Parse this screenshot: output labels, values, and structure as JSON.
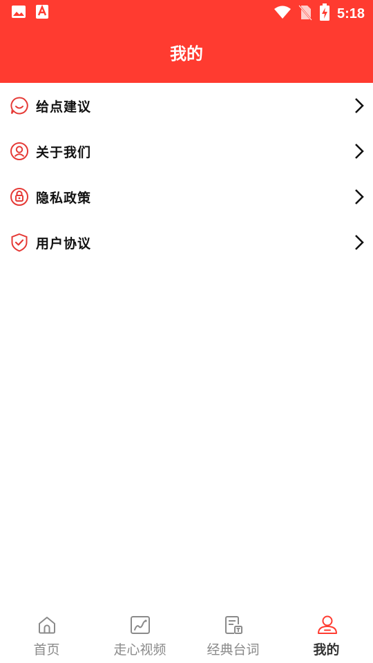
{
  "status_bar": {
    "time": "5:18",
    "left_icons": [
      "image-icon",
      "app-a-icon"
    ],
    "right_icons": [
      "wifi-icon",
      "no-sim-icon",
      "battery-charging-icon"
    ]
  },
  "header": {
    "title": "我的",
    "background_color": "#FF3B30"
  },
  "menu": {
    "accent_color": "#E53935",
    "items": [
      {
        "label": "给点建议",
        "icon": "chat-bubble-icon"
      },
      {
        "label": "关于我们",
        "icon": "user-circle-icon"
      },
      {
        "label": "隐私政策",
        "icon": "lock-circle-icon"
      },
      {
        "label": "用户协议",
        "icon": "shield-check-icon"
      }
    ]
  },
  "bottom_nav": {
    "active_index": 3,
    "active_color": "#FF3B30",
    "items": [
      {
        "label": "首页",
        "icon": "home-icon"
      },
      {
        "label": "走心视频",
        "icon": "video-chart-icon"
      },
      {
        "label": "经典台词",
        "icon": "document-text-icon"
      },
      {
        "label": "我的",
        "icon": "user-icon"
      }
    ]
  }
}
